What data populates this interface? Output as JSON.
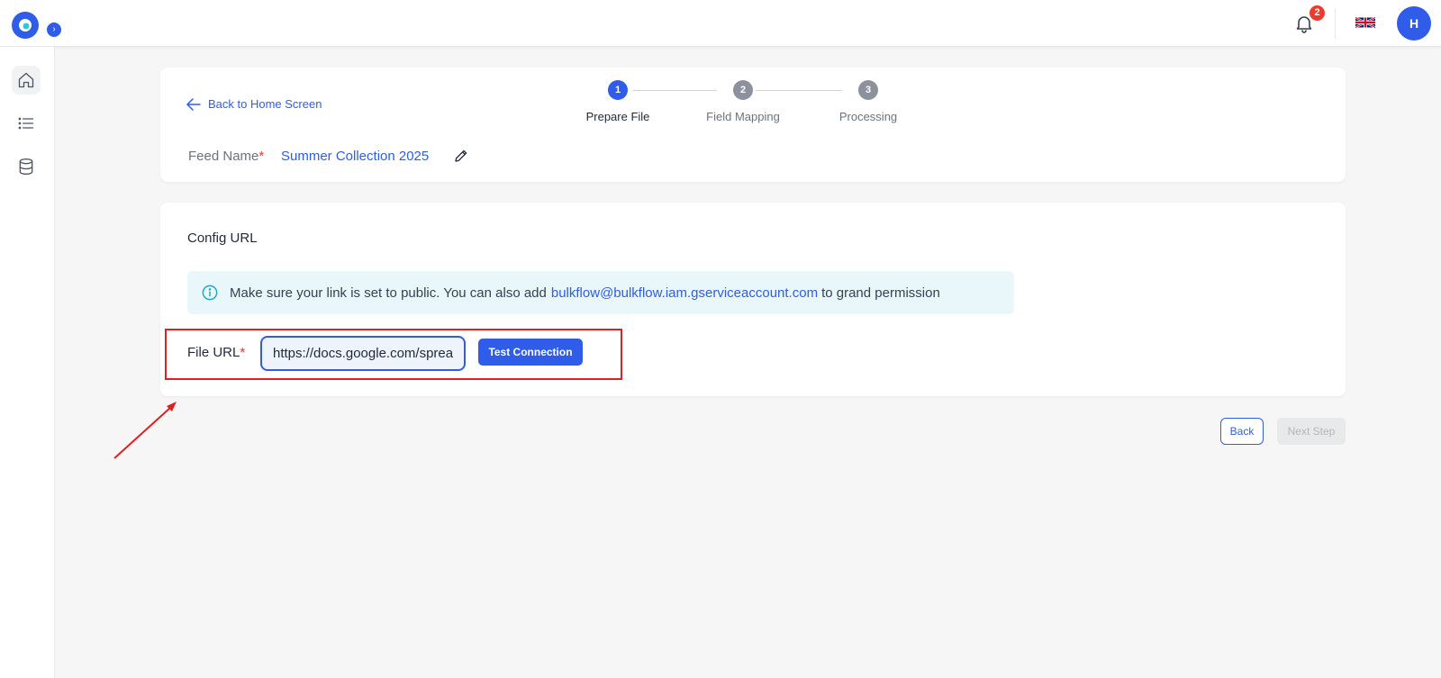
{
  "header": {
    "expand_icon": "chevron-right-icon",
    "notifications": {
      "icon": "bell-icon",
      "count": "2"
    },
    "language": {
      "icon": "uk-flag-icon"
    },
    "user": {
      "initial": "H"
    },
    "colors": {
      "primary": "#2f5ce9",
      "badge": "#ef3b2d",
      "accent": "#30c8d8"
    }
  },
  "sidebar": {
    "items": [
      {
        "icon": "home-icon",
        "active": true
      },
      {
        "icon": "list-icon",
        "active": false
      },
      {
        "icon": "database-icon",
        "active": false
      }
    ]
  },
  "top_card": {
    "back_link": "Back to Home Screen",
    "feed_label": "Feed Name",
    "required_mark": "*",
    "feed_name": "Summer Collection 2025",
    "edit_icon": "pencil-icon"
  },
  "steps": [
    {
      "number": "1",
      "label": "Prepare File",
      "state": "active"
    },
    {
      "number": "2",
      "label": "Field Mapping",
      "state": "pending"
    },
    {
      "number": "3",
      "label": "Processing",
      "state": "pending"
    }
  ],
  "config": {
    "title": "Config URL",
    "info": {
      "icon": "info-icon",
      "text_before": "Make sure your link is set to public. You can also add",
      "email": "bulkflow@bulkflow.iam.gserviceaccount.com",
      "text_after": "to grand permission"
    },
    "file_url": {
      "label": "File URL",
      "required_mark": "*",
      "value": "https://docs.google.com/spreadsheets"
    },
    "test_button": "Test Connection"
  },
  "footer": {
    "back_button": "Back",
    "next_button": "Next Step"
  }
}
